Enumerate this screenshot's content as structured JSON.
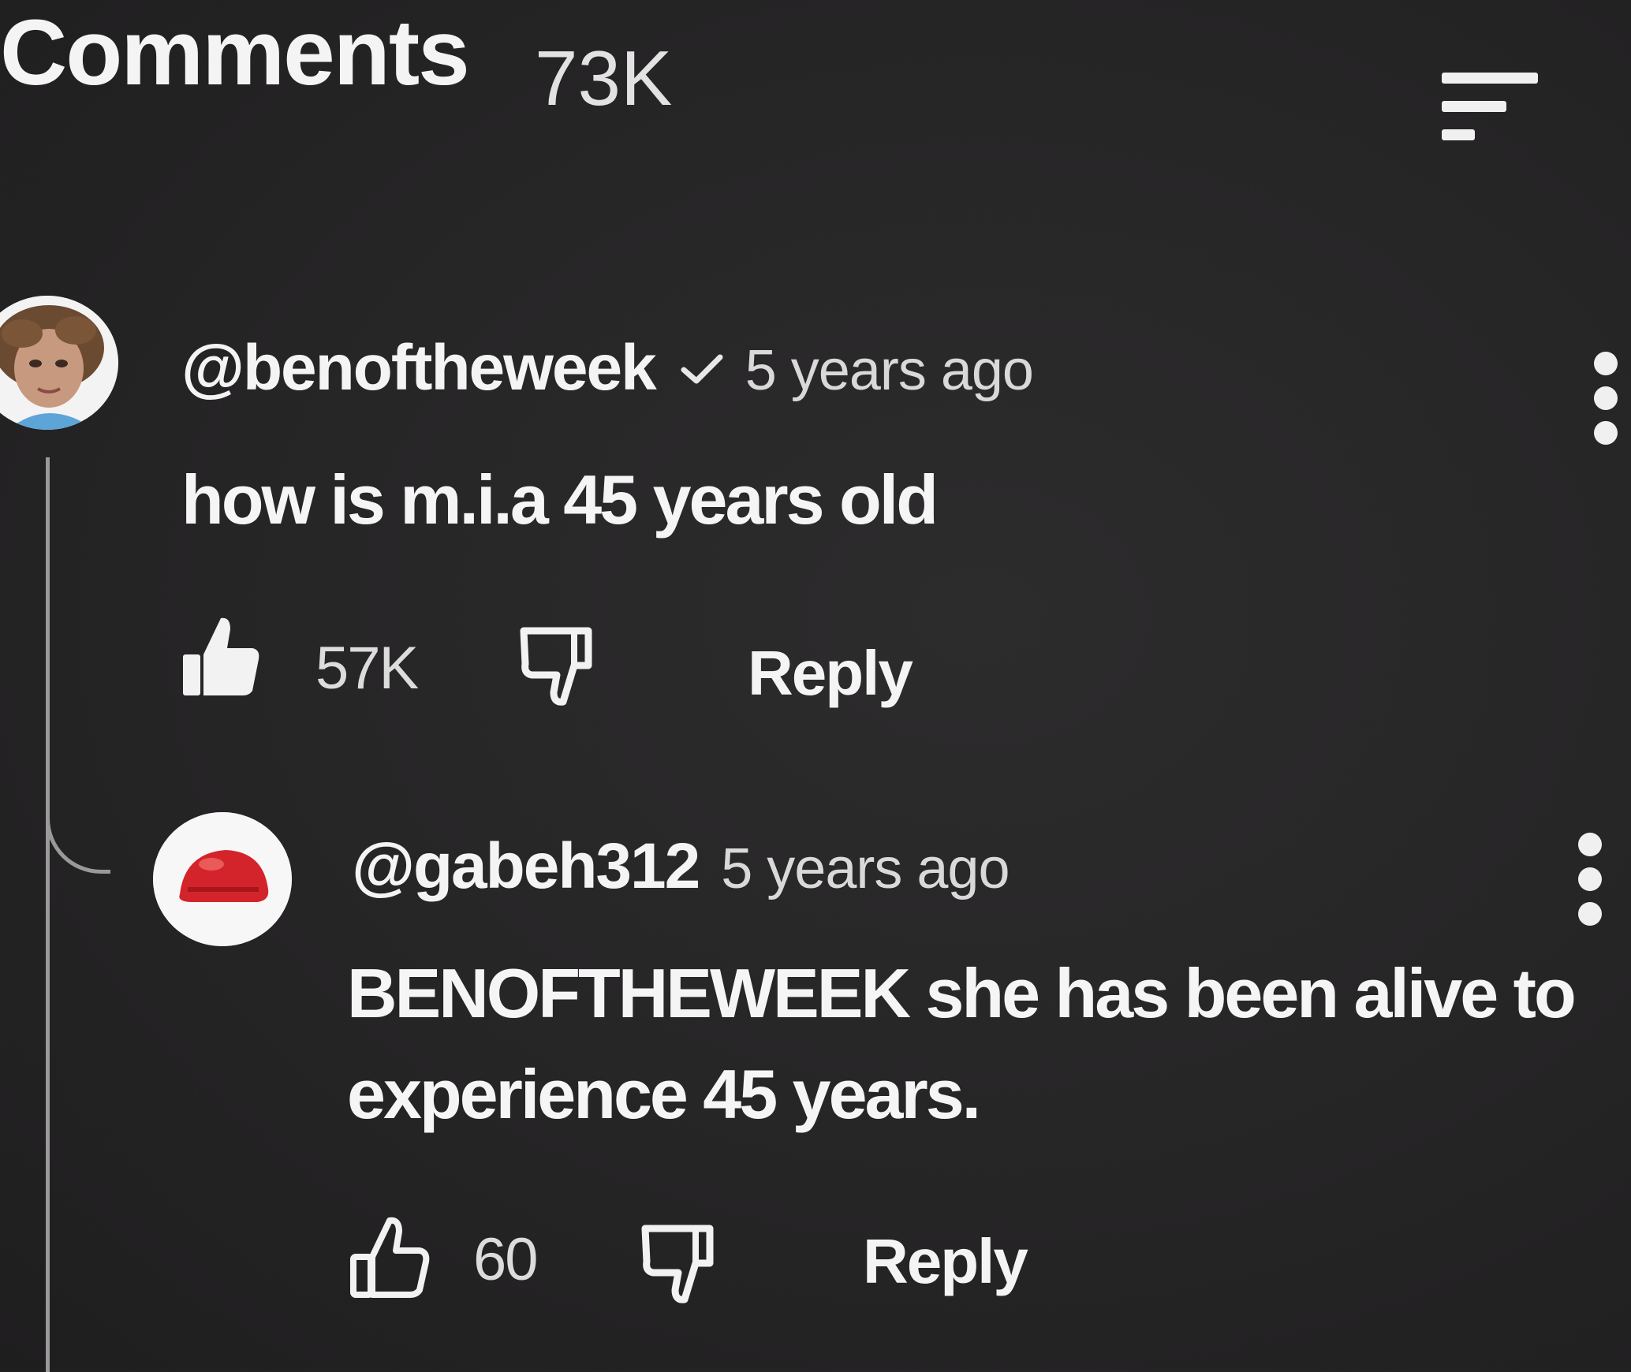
{
  "header": {
    "title": "Comments",
    "count": "73K",
    "sort_icon": "sort-icon"
  },
  "comments": [
    {
      "author": "@benoftheweek",
      "verified": true,
      "time": "5 years ago",
      "text": "how is m.i.a 45 years old",
      "likes": "57K",
      "reply_label": "Reply",
      "like_style": "filled"
    },
    {
      "author": "@gabeh312",
      "verified": false,
      "time": "5 years ago",
      "text": "BENOFTHEWEEK she has been alive to experience 45 years.",
      "likes": "60",
      "reply_label": "Reply",
      "like_style": "outline"
    }
  ],
  "colors": {
    "background": "#262526",
    "text": "#f2f2f2",
    "secondary_text": "#d9d9d9",
    "thread_line": "#9a9a9a",
    "avatar_red": "#d4242b"
  }
}
